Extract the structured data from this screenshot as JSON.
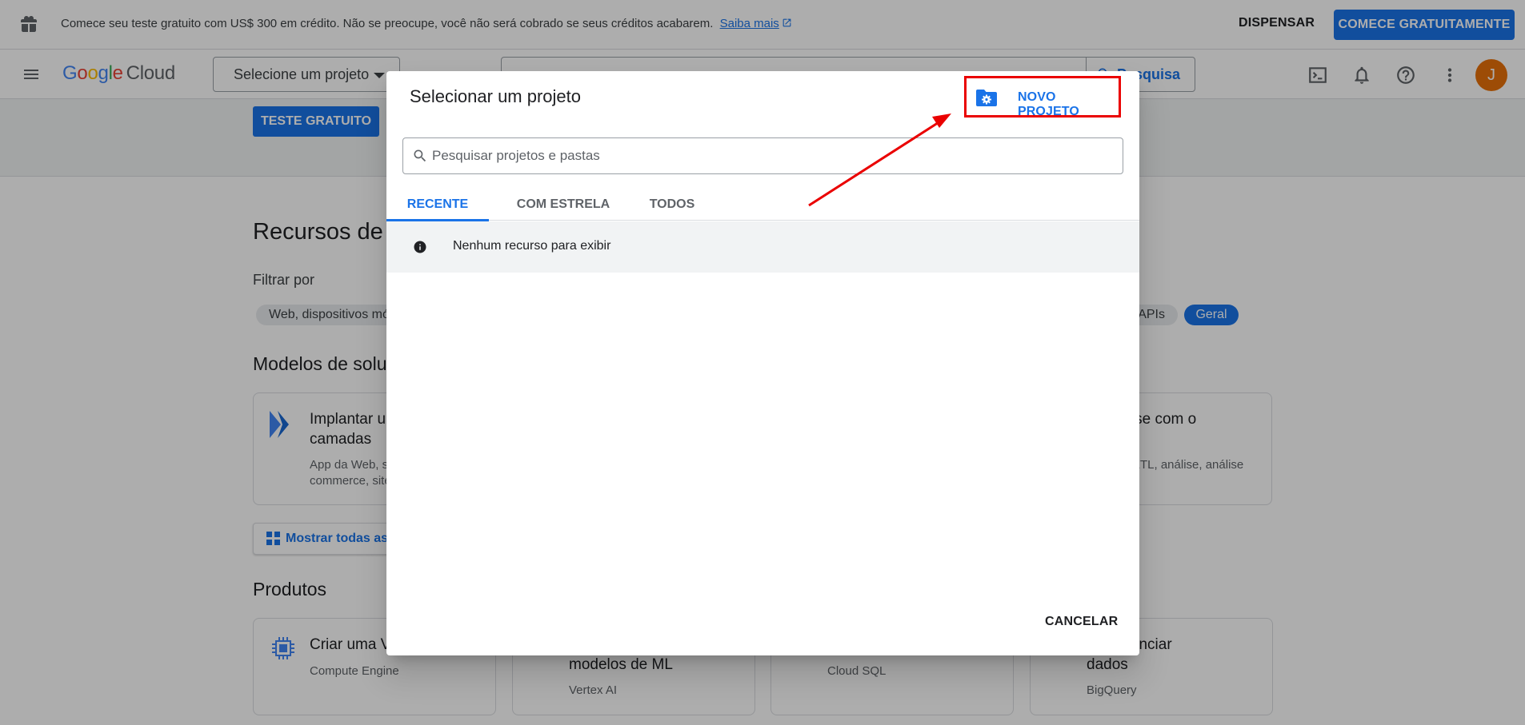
{
  "banner": {
    "message": "Comece seu teste gratuito com US$ 300 em crédito. Não se preocupe, você não será cobrado se seus créditos acabarem.",
    "link_label": "Saiba mais",
    "dismiss_label": "DISPENSAR",
    "start_label": "COMECE GRATUITAMENTE"
  },
  "topnav": {
    "logo_google": "Google",
    "logo_cloud": "Cloud",
    "project_selector_label": "Selecione um projeto",
    "search_button_label": "Pesquisa",
    "avatar_initial": "J"
  },
  "background": {
    "trial_button": "TESTE GRATUITO",
    "resources_heading": "Recursos de",
    "filter_label": "Filtrar por",
    "chips": [
      "Web, dispositivos mó",
      "APIs",
      "Geral"
    ],
    "models_heading": "Modelos de soluç",
    "card_deploy_title": "Implantar um\ncamadas",
    "card_deploy_desc": "App da Web, si\ncommerce, site",
    "card_warehouse_title": "ouse com o",
    "card_warehouse_desc": "ETL, análise, análise",
    "show_all": "Mostrar todas as",
    "products_heading": "Produtos",
    "products": [
      {
        "title": "Criar uma V",
        "subtitle": "Compute Engine"
      },
      {
        "title": "modelos de ML",
        "subtitle": "Vertex AI"
      },
      {
        "title": "",
        "subtitle": "Cloud SQL"
      },
      {
        "title": "r e gerenciar\ndados",
        "subtitle": "BigQuery"
      }
    ]
  },
  "dialog": {
    "title": "Selecionar um projeto",
    "new_project_label": "NOVO PROJETO",
    "search_placeholder": "Pesquisar projetos e pastas",
    "tabs": [
      {
        "label": "RECENTE",
        "active": true
      },
      {
        "label": "COM ESTRELA",
        "active": false
      },
      {
        "label": "TODOS",
        "active": false
      }
    ],
    "empty_message": "Nenhum recurso para exibir",
    "cancel_label": "CANCELAR"
  },
  "colors": {
    "accent": "#1a73e8",
    "annotation": "#ea0000",
    "avatar": "#e8710a"
  },
  "icons": [
    "gift-icon",
    "external-link-icon",
    "menu-icon",
    "search-icon",
    "terminal-icon",
    "bell-icon",
    "help-icon",
    "more-vert-icon",
    "folder-settings-icon",
    "info-icon"
  ]
}
